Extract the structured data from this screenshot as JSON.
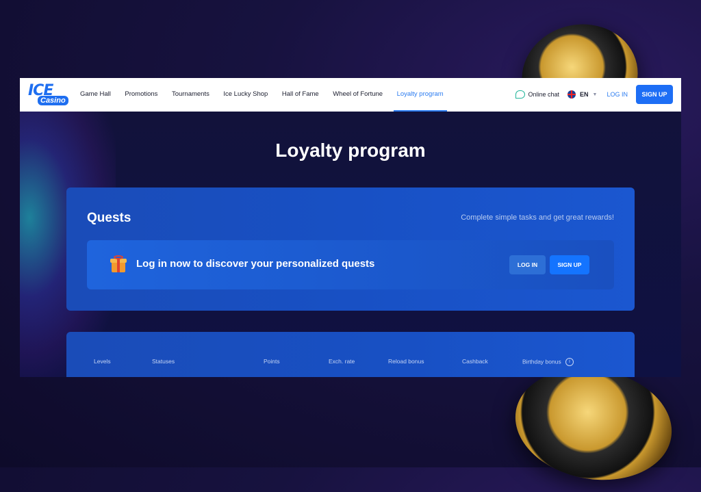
{
  "header": {
    "logo_text": "ICE",
    "logo_sub": "Casino",
    "nav": [
      {
        "label": "Game Hall"
      },
      {
        "label": "Promotions"
      },
      {
        "label": "Tournaments"
      },
      {
        "label": "Ice Lucky Shop"
      },
      {
        "label": "Hall of Fame"
      },
      {
        "label": "Wheel of Fortune"
      },
      {
        "label": "Loyalty program",
        "active": true
      }
    ],
    "online_chat": "Online chat",
    "language": "EN",
    "login": "LOG IN",
    "signup": "SIGN UP"
  },
  "hero": {
    "title": "Loyalty program"
  },
  "quests": {
    "title": "Quests",
    "subtitle": "Complete simple tasks and get great rewards!",
    "banner_text": "Log in now to discover your personalized quests",
    "login": "LOG IN",
    "signup": "SIGN UP"
  },
  "levels_table": {
    "columns": [
      "Levels",
      "Statuses",
      "Points",
      "Exch. rate",
      "Reload bonus",
      "Cashback",
      "Birthday bonus"
    ]
  },
  "colors": {
    "accent": "#1d6ef5",
    "card": "#1850c4",
    "background": "#0f1142"
  },
  "icons": {
    "chat": "chat-bubble-icon",
    "language": "uk-flag-icon",
    "gift": "gift-icon",
    "info": "info-icon"
  }
}
